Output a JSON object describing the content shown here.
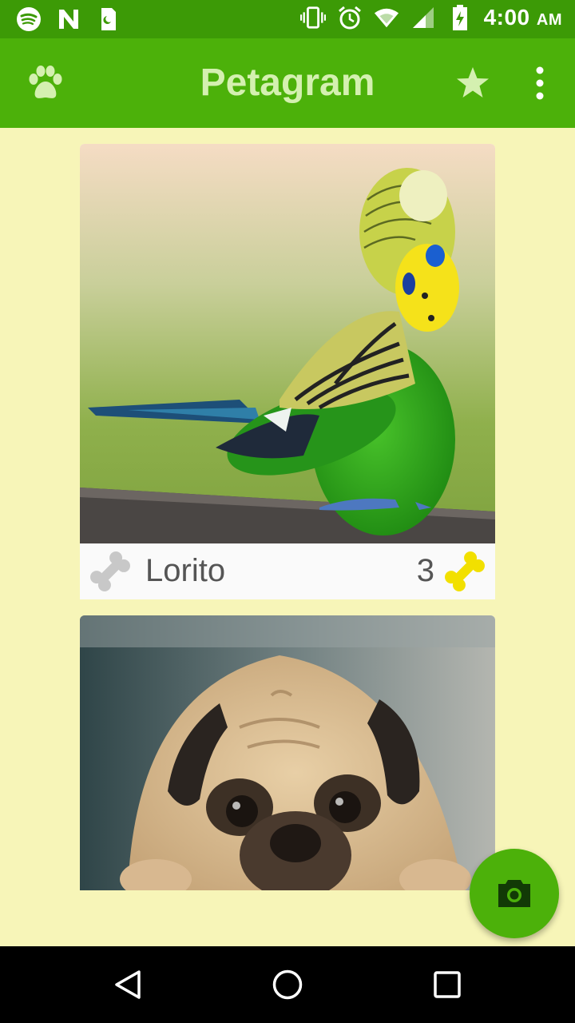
{
  "status_bar": {
    "time": "4:00",
    "ampm": "AM",
    "left_icons": [
      "spotify-icon",
      "n-app-icon",
      "sim-notification-icon"
    ],
    "right_icons": [
      "vibrate-icon",
      "alarm-icon",
      "wifi-icon",
      "signal-icon",
      "battery-charging-icon"
    ]
  },
  "app_bar": {
    "title": "Petagram",
    "left_icon": "paw-icon",
    "action_icons": [
      "star-icon",
      "more-vert-icon"
    ]
  },
  "pets": [
    {
      "name": "Lorito",
      "likes": "3",
      "photo": "budgie-parrot-photo"
    },
    {
      "name": "",
      "likes": "",
      "photo": "pug-dog-photo"
    }
  ],
  "fab": {
    "icon": "camera-icon"
  },
  "nav_bar": {
    "icons": [
      "back-icon",
      "home-icon",
      "recents-icon"
    ]
  },
  "colors": {
    "status_bar": "#3c9a06",
    "app_bar": "#4cb10a",
    "title_text": "#d4f0b0",
    "background": "#f7f5b8",
    "bone_yellow": "#f2e000",
    "bone_gray": "#c8c8c8"
  }
}
